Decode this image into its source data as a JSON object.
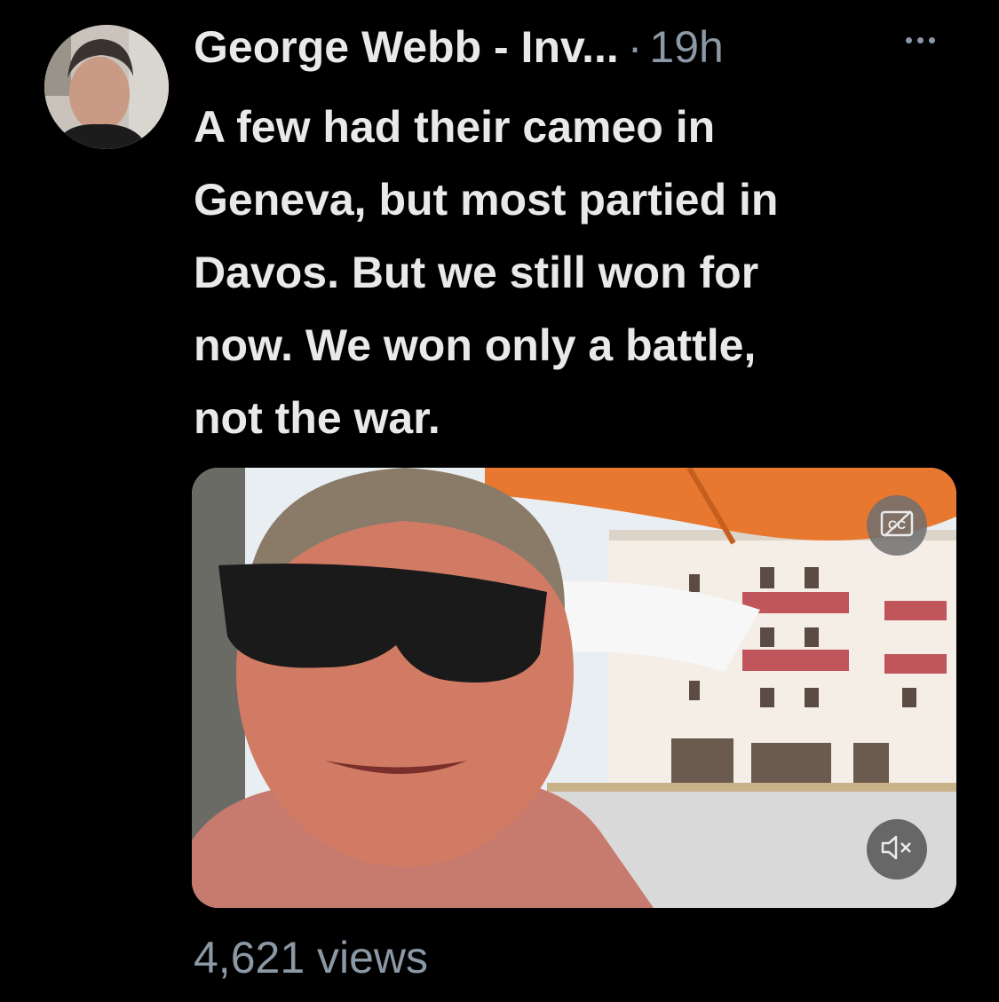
{
  "tweet": {
    "author_name": "George Webb - Inv...",
    "separator": "·",
    "timestamp": "19h",
    "more_icon": "more-horizontal-icon",
    "text_lines": [
      "A few had their cameo in",
      "Geneva, but most partied in",
      "Davos. But we still won for",
      "now. We won only a battle,",
      "not the war."
    ],
    "views": "4,621 views"
  },
  "video": {
    "captions_icon": "closed-captions-off-icon",
    "captions_glyph": "CC",
    "mute_icon": "speaker-muted-icon"
  },
  "colors": {
    "background": "#000000",
    "primary_text": "#e9e9e9",
    "secondary_text": "#8b98a5",
    "umbrella_orange": "#e8782f"
  }
}
